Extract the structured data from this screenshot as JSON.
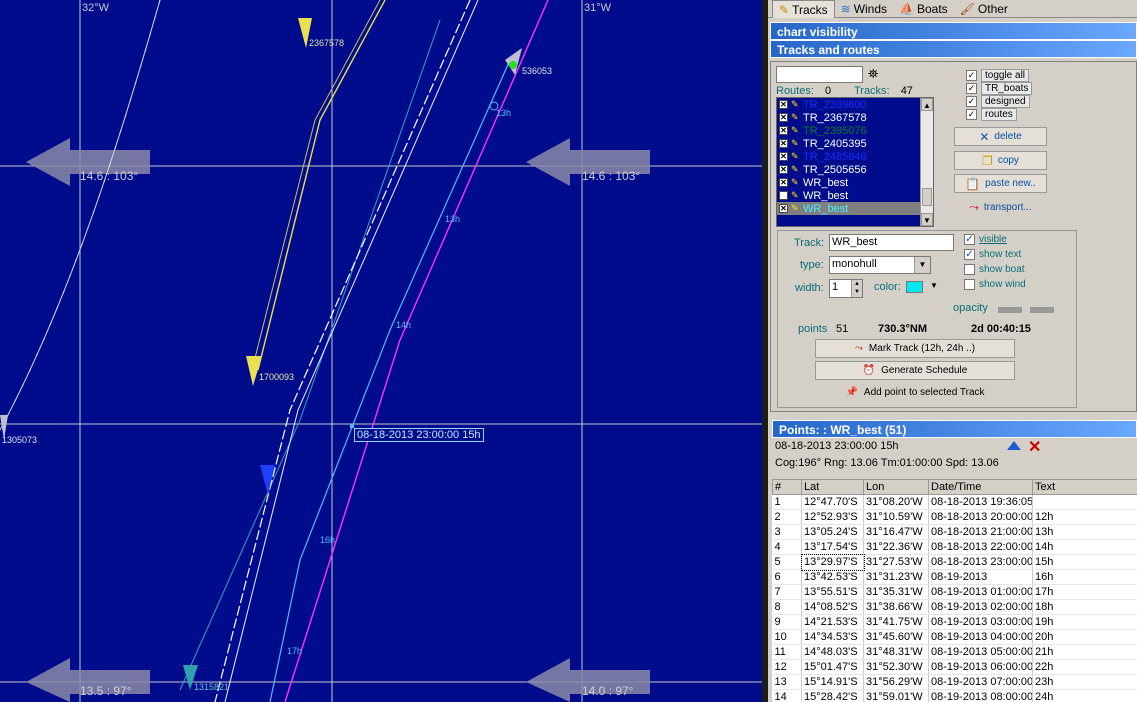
{
  "map": {
    "grid_labels": {
      "lon_left": "32°W",
      "lon_right": "31°W"
    },
    "wind_labels": [
      "14.6 : 103°",
      "14.6 : 103°",
      "13.5 : 97°",
      "14.0 : 97°"
    ],
    "boat_labels": {
      "b1": "2367578",
      "b2": "536053",
      "b3": "1305073",
      "b4": "1700093",
      "b5": "1315821"
    },
    "hour_labels": [
      "13h",
      "13h",
      "14h",
      "16h",
      "17h"
    ],
    "selected_point_label": "08-18-2013 23:00:00 15h",
    "colors": {
      "sea": "#000c8c",
      "magenta_track": "#ff30ff",
      "cyan_track": "#58b8ff",
      "white_track": "#ffffff",
      "yellow_track": "#e8e050",
      "wind_arrow": "#8a8aa8"
    }
  },
  "tabs": [
    {
      "label": "Tracks",
      "icon": "pencil-icon"
    },
    {
      "label": "Winds",
      "icon": "wind-icon"
    },
    {
      "label": "Boats",
      "icon": "boat-icon"
    },
    {
      "label": "Other",
      "icon": "brush-icon"
    }
  ],
  "panel": {
    "chart_visibility": "chart visibility",
    "tracks_routes_title": "Tracks and routes",
    "search_value": "",
    "routes_label": "Routes:",
    "routes_count": "0",
    "tracks_label": "Tracks:",
    "tracks_count": "47",
    "track_list": [
      {
        "name": "TR_2339800",
        "checked": true,
        "color": "#1a2aff"
      },
      {
        "name": "TR_2367578",
        "checked": true,
        "color": "#ffffff"
      },
      {
        "name": "TR_2395076",
        "checked": true,
        "color": "#0c7a2a"
      },
      {
        "name": "TR_2405395",
        "checked": true,
        "color": "#ffffff"
      },
      {
        "name": "TR_2485846",
        "checked": true,
        "color": "#1a2aff"
      },
      {
        "name": "TR_2505656",
        "checked": true,
        "color": "#ffffff"
      },
      {
        "name": "WR_best",
        "checked": true,
        "color": "#ffffff"
      },
      {
        "name": "WR_best",
        "checked": false,
        "color": "#ffffff"
      },
      {
        "name": "WR_best",
        "checked": true,
        "color": "#40f0ff"
      }
    ],
    "toggles": [
      "toggle all",
      "TR_boats",
      "designed",
      "routes"
    ],
    "buttons": {
      "delete": "delete",
      "copy": "copy",
      "paste_new": "paste new..",
      "transport": "transport..."
    },
    "track_props": {
      "track_label": "Track:",
      "track_name": "WR_best",
      "type_label": "type:",
      "type_value": "monohull",
      "width_label": "width:",
      "width_value": "1",
      "color_label": "color:",
      "visible": "visible",
      "show_text": "show text",
      "show_boat": "show boat",
      "show_wind": "show wind",
      "opacity_label": "opacity",
      "points_label": "points",
      "points_value": "51",
      "distance": "730.3°NM",
      "duration": "2d 00:40:15",
      "mark_track": "Mark Track (12h, 24h ..)",
      "generate_schedule": "Generate Schedule",
      "add_point": "Add point to selected Track"
    },
    "points_title": "Points: : WR_best (51)",
    "selected_point": "08-18-2013 23:00:00 15h",
    "cog_info": "Cog:196° Rng: 13.06 Tm:01:00:00 Spd: 13.06"
  },
  "points_table": {
    "headers": [
      "#",
      "Lat",
      "Lon",
      "Date/Time",
      "Text"
    ],
    "rows": [
      [
        "1",
        "12°47.70'S",
        "31°08.20'W",
        "08-18-2013 19:36:05",
        ""
      ],
      [
        "2",
        "12°52.93'S",
        "31°10.59'W",
        "08-18-2013 20:00:00",
        "12h"
      ],
      [
        "3",
        "13°05.24'S",
        "31°16.47'W",
        "08-18-2013 21:00:00",
        "13h"
      ],
      [
        "4",
        "13°17.54'S",
        "31°22.36'W",
        "08-18-2013 22:00:00",
        "14h"
      ],
      [
        "5",
        "13°29.97'S",
        "31°27.53'W",
        "08-18-2013 23:00:00",
        "15h"
      ],
      [
        "6",
        "13°42.53'S",
        "31°31.23'W",
        "08-19-2013",
        "16h"
      ],
      [
        "7",
        "13°55.51'S",
        "31°35.31'W",
        "08-19-2013 01:00:00",
        "17h"
      ],
      [
        "8",
        "14°08.52'S",
        "31°38.66'W",
        "08-19-2013 02:00:00",
        "18h"
      ],
      [
        "9",
        "14°21.53'S",
        "31°41.75'W",
        "08-19-2013 03:00:00",
        "19h"
      ],
      [
        "10",
        "14°34.53'S",
        "31°45.60'W",
        "08-19-2013 04:00:00",
        "20h"
      ],
      [
        "11",
        "14°48.03'S",
        "31°48.31'W",
        "08-19-2013 05:00:00",
        "21h"
      ],
      [
        "12",
        "15°01.47'S",
        "31°52.30'W",
        "08-19-2013 06:00:00",
        "22h"
      ],
      [
        "13",
        "15°14.91'S",
        "31°56.29'W",
        "08-19-2013 07:00:00",
        "23h"
      ],
      [
        "14",
        "15°28.42'S",
        "31°59.01'W",
        "08-19-2013 08:00:00",
        "24h"
      ]
    ]
  }
}
